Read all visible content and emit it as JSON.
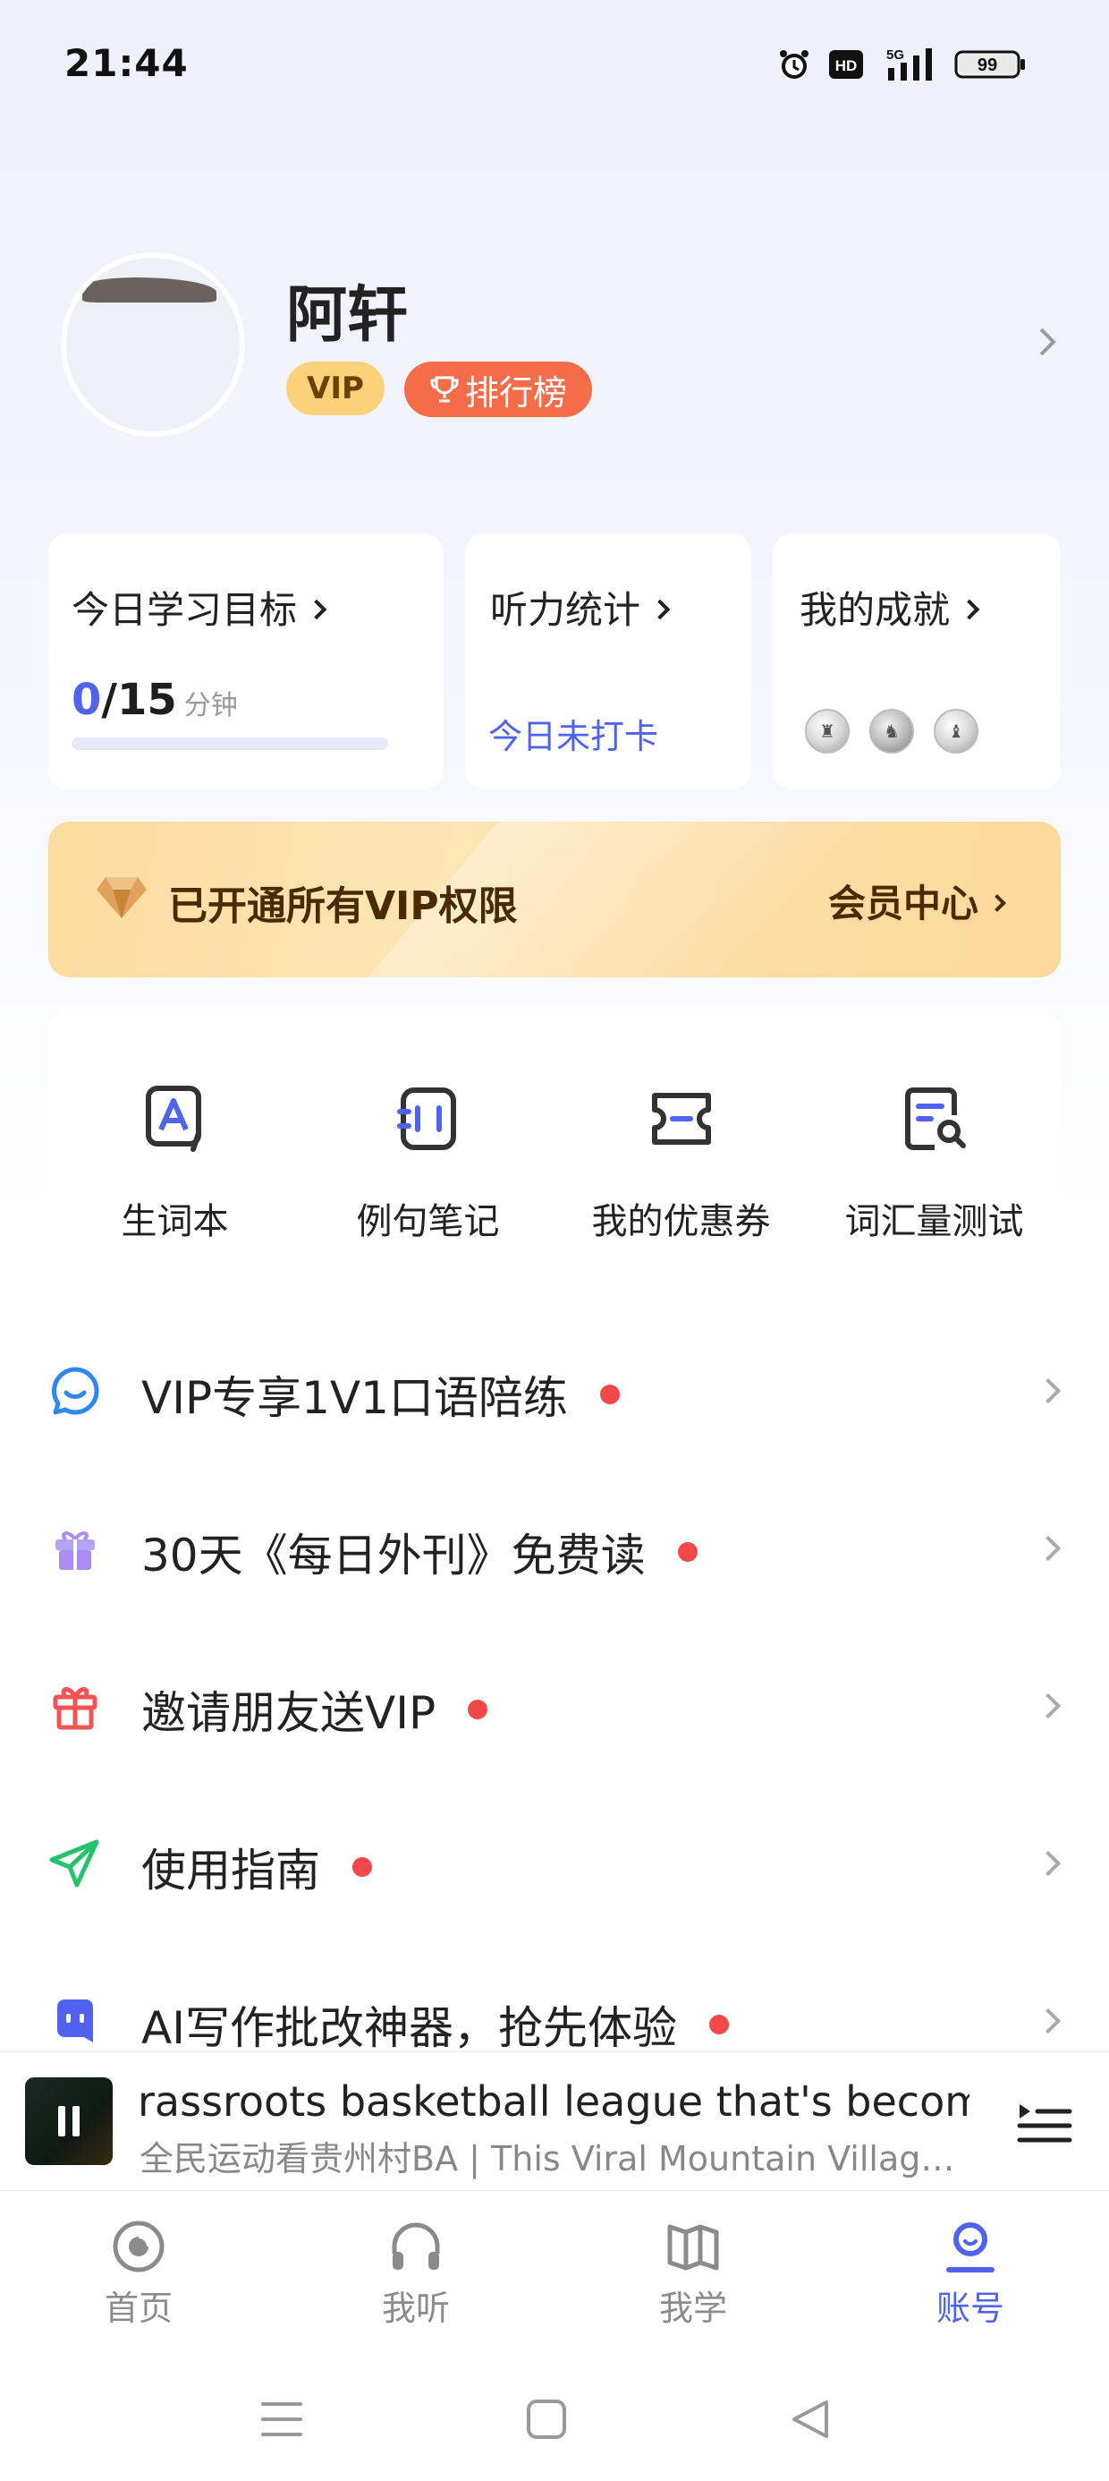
{
  "status_bar": {
    "time": "21:44",
    "network": "5G",
    "battery": "99"
  },
  "profile": {
    "name": "阿轩",
    "vip_badge": "VIP",
    "rank_badge": "排行榜"
  },
  "stats": {
    "goal": {
      "title": "今日学习目标",
      "current": "0",
      "total": "/15",
      "unit": "分钟",
      "progress": 0
    },
    "listening": {
      "title": "听力统计",
      "status": "今日未打卡"
    },
    "achievements": {
      "title": "我的成就",
      "medals": [
        "medal-1",
        "medal-2",
        "medal-3"
      ]
    }
  },
  "vip_banner": {
    "text": "已开通所有VIP权限",
    "action": "会员中心"
  },
  "tools": [
    {
      "label": "生词本",
      "icon": "wordbook-icon"
    },
    {
      "label": "例句笔记",
      "icon": "sentence-notes-icon"
    },
    {
      "label": "我的优惠券",
      "icon": "coupon-icon"
    },
    {
      "label": "词汇量测试",
      "icon": "vocab-test-icon"
    }
  ],
  "menu": [
    {
      "label": "VIP专享1V1口语陪练",
      "icon": "chat-bubble-icon",
      "color": "#2f86f6"
    },
    {
      "label": "30天《每日外刊》免费读",
      "icon": "gift-box-icon",
      "color": "#a98df0"
    },
    {
      "label": "邀请朋友送VIP",
      "icon": "gift-icon",
      "color": "#f25454"
    },
    {
      "label": "使用指南",
      "icon": "paper-plane-icon",
      "color": "#23c26d"
    },
    {
      "label": "AI写作批改神器，抢先体验",
      "icon": "robot-icon",
      "color": "#4f63f0"
    }
  ],
  "player": {
    "title": "rassroots basketball league that's become",
    "subtitle": "全民运动看贵州村BA | This Viral Mountain Village H..."
  },
  "tabs": [
    {
      "label": "首页",
      "icon": "home-icon",
      "active": false
    },
    {
      "label": "我听",
      "icon": "headphones-icon",
      "active": false
    },
    {
      "label": "我学",
      "icon": "book-icon",
      "active": false
    },
    {
      "label": "账号",
      "icon": "account-icon",
      "active": true
    }
  ],
  "colors": {
    "accent": "#4f63f0",
    "vip_gold": "#fbd27a",
    "rank_orange": "#f46c4a",
    "notify_red": "#f24848"
  }
}
